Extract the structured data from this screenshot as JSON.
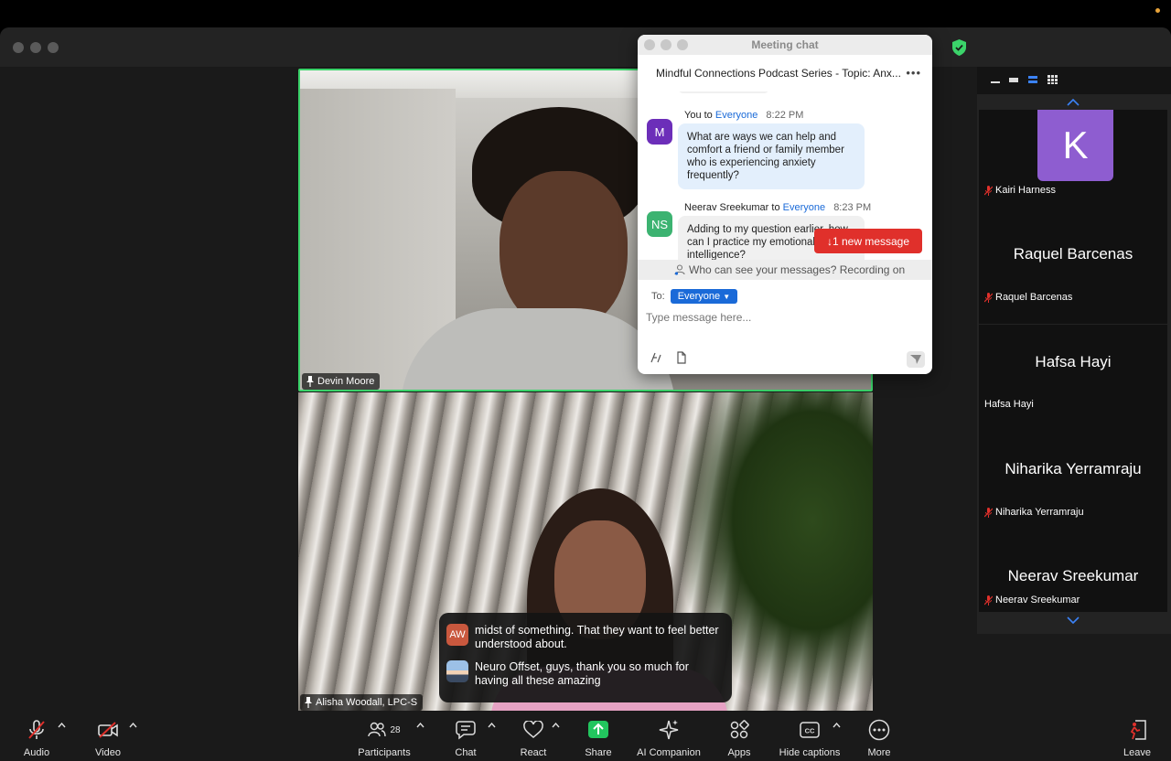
{
  "window": {
    "title": ""
  },
  "chat": {
    "window_title": "Meeting chat",
    "topic": "Mindful Connections Podcast Series - Topic:  Anx...",
    "more": "•••",
    "messages": [
      {
        "avatar": "M",
        "avatar_color": "#6c2eb9",
        "sender": "You",
        "to_word": "to",
        "to": "Everyone",
        "time": "8:22 PM",
        "text": "What are ways we can help and comfort a friend or family member who is experiencing anxiety frequently?"
      },
      {
        "avatar": "NS",
        "avatar_color": "#3cb371",
        "sender": "Neerav Sreekumar",
        "to_word": "to",
        "to": "Everyone",
        "time": "8:23 PM",
        "text": "Adding to my question earlier, how can I practice my emotional intelligence?"
      }
    ],
    "new_message": "↓1 new message",
    "who_can_see": "Who can see your messages? Recording on",
    "to_label": "To:",
    "to_value": "Everyone",
    "input_placeholder": "Type message here..."
  },
  "video": {
    "top_name": "Devin Moore",
    "bottom_name": "Alisha Woodall, LPC-S"
  },
  "captions": [
    {
      "avatar": "AW",
      "avatar_color": "#c9583e",
      "text": "midst of something. That they want to feel better understood about."
    },
    {
      "avatar": "",
      "avatar_color": "#6b8fb5",
      "text": "Neuro Offset, guys, thank you so much for having all these amazing"
    }
  ],
  "side_panel": {
    "participants": [
      {
        "initial": "K",
        "big_name": "",
        "name": "Kairi Harness",
        "muted": true
      },
      {
        "initial": "",
        "big_name": "Raquel Barcenas",
        "name": "Raquel Barcenas",
        "muted": true
      },
      {
        "initial": "",
        "big_name": "Hafsa Hayi",
        "name": "Hafsa Hayi",
        "muted": false
      },
      {
        "initial": "",
        "big_name": "Niharika Yerramraju",
        "name": "Niharika Yerramraju",
        "muted": true
      },
      {
        "initial": "",
        "big_name": "Neerav Sreekumar",
        "name": "Neerav Sreekumar",
        "muted": true
      }
    ]
  },
  "toolbar": {
    "audio": "Audio",
    "video": "Video",
    "participants": "Participants",
    "participants_count": "28",
    "chat": "Chat",
    "react": "React",
    "share": "Share",
    "ai_companion": "AI Companion",
    "apps": "Apps",
    "hide_captions": "Hide captions",
    "more": "More",
    "leave": "Leave"
  },
  "colors": {
    "accent_blue": "#1a6ad8",
    "active_speaker": "#3bd36a",
    "share_green": "#22c55e",
    "danger_red": "#e0302b"
  }
}
